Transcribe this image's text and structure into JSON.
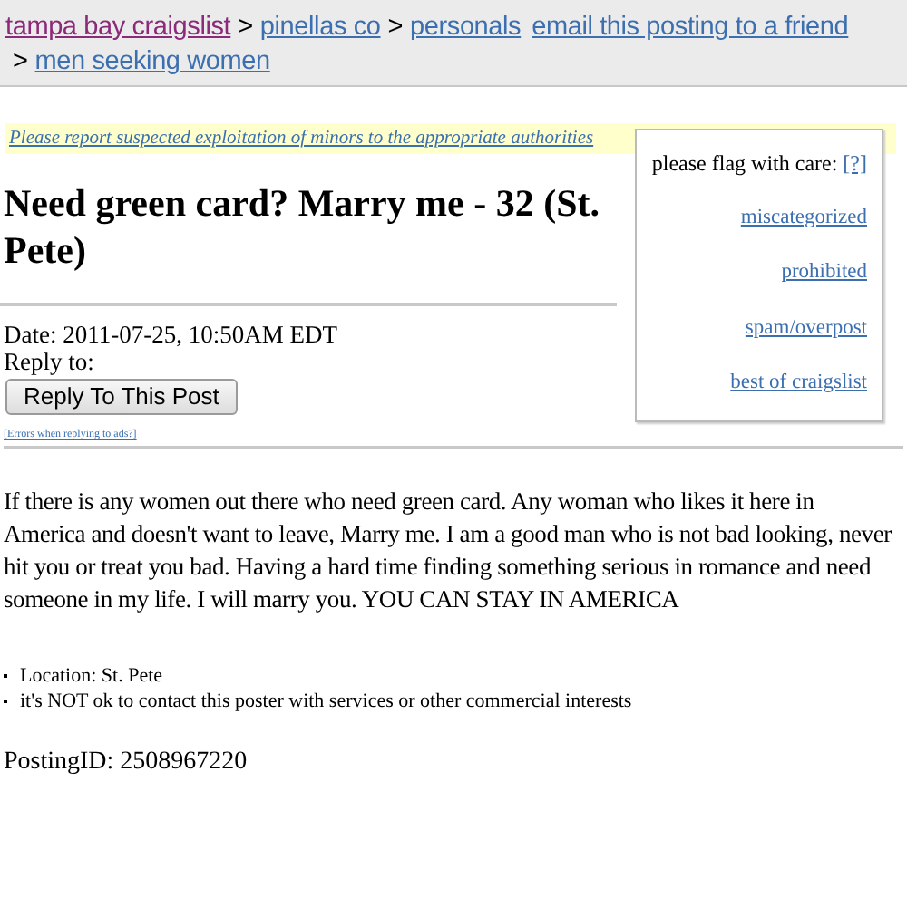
{
  "breadcrumbs": [
    {
      "label": "tampa bay craigslist",
      "visited": true
    },
    {
      "label": "pinellas co",
      "visited": false
    },
    {
      "label": "personals",
      "visited": false
    },
    {
      "label": "men seeking women",
      "visited": false
    }
  ],
  "separator": ">",
  "email_link": "email this posting to a friend",
  "notice_link": "Please report suspected exploitation of minors to the appropriate authorities",
  "flag_box": {
    "label": "please flag with care:",
    "help_link": "[?]",
    "links": [
      "miscategorized",
      "prohibited",
      "spam/overpost",
      "best of craigslist"
    ]
  },
  "title": "Need green card? Marry me - 32 (St. Pete)",
  "date": "Date: 2011-07-25, 10:50AM EDT",
  "reply_to": "Reply to:",
  "reply_button": "Reply To This Post",
  "errors_link": "[Errors when replying to ads?]",
  "body": "If there is any women out there who need green card. Any woman who likes it here in America and doesn't want to leave, Marry me. I am a good man who is not bad looking, never hit you or treat you bad. Having a hard time finding something serious in romance and need someone in my life. I will marry you. YOU CAN STAY IN AMERICA",
  "details": [
    "Location: St. Pete",
    "it's NOT ok to contact this poster with services or other commercial interests"
  ],
  "posting_id": "PostingID: 2508967220"
}
